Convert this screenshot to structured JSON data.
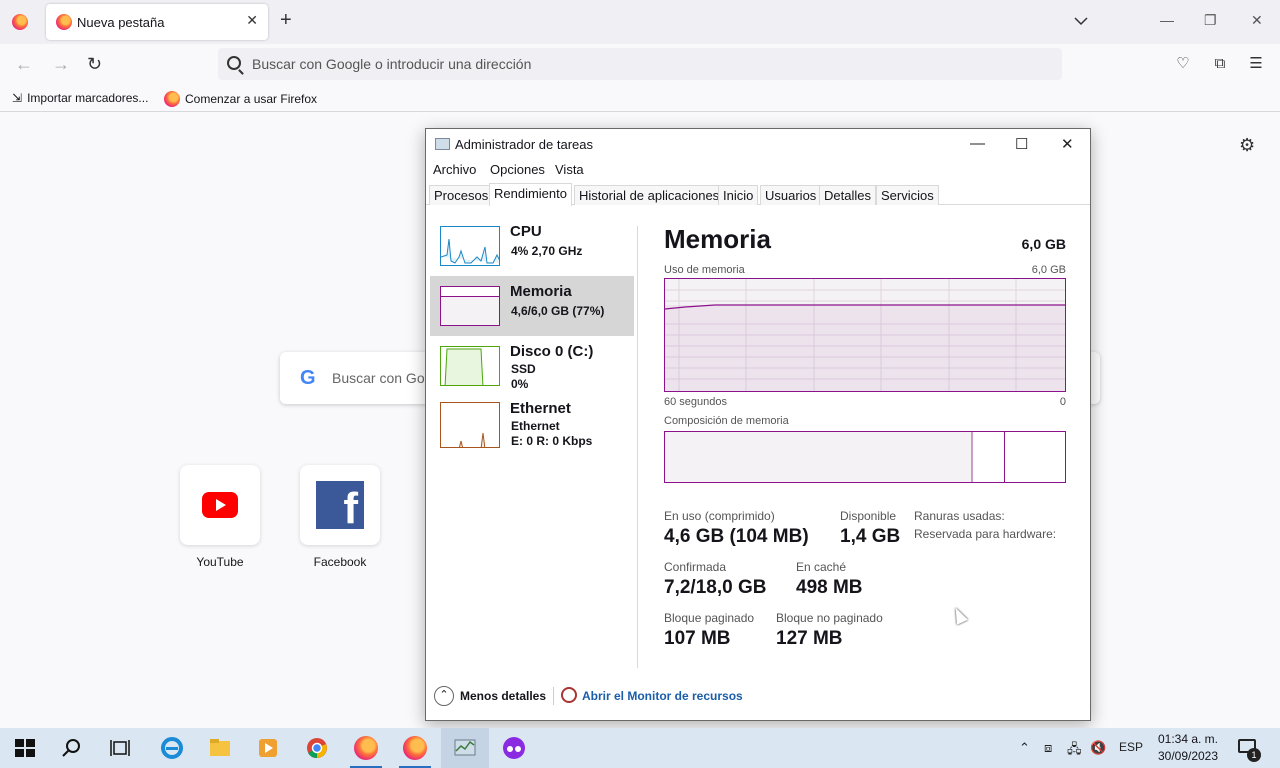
{
  "browser": {
    "tab_title": "Nueva pestaña",
    "url_placeholder": "Buscar con Google o introducir una dirección",
    "bookmarks": [
      "Importar marcadores...",
      "Comenzar a usar Firefox"
    ],
    "new_tab_label": "+",
    "google_search_placeholder": "Buscar con Google o introducir una dirección",
    "google_logo": "G",
    "shortcuts": [
      {
        "label": "YouTube",
        "icon": "youtube-icon"
      },
      {
        "label": "Facebook",
        "icon": "facebook-icon"
      }
    ]
  },
  "task_manager": {
    "title": "Administrador de tareas",
    "menu": [
      "Archivo",
      "Opciones",
      "Vista"
    ],
    "tabs": [
      "Procesos",
      "Rendimiento",
      "Historial de aplicaciones",
      "Inicio",
      "Usuarios",
      "Detalles",
      "Servicios"
    ],
    "active_tab": "Rendimiento",
    "perf_items": [
      {
        "name": "CPU",
        "sub1": "4% 2,70 GHz",
        "sub2": "",
        "color": "#1a88c8"
      },
      {
        "name": "Memoria",
        "sub1": "4,6/6,0 GB (77%)",
        "sub2": "",
        "color": "#8b128b"
      },
      {
        "name": "Disco 0 (C:)",
        "sub1": "SSD",
        "sub2": "0%",
        "color": "#4da60c"
      },
      {
        "name": "Ethernet",
        "sub1": "Ethernet",
        "sub2": "E: 0 R: 0 Kbps",
        "color": "#a7541d"
      }
    ],
    "detail": {
      "title": "Memoria",
      "total": "6,0 GB",
      "usage_label": "Uso de memoria",
      "usage_max": "6,0 GB",
      "time_left": "60 segundos",
      "time_right": "0",
      "composition_label": "Composición de memoria",
      "usage_fraction": 0.77,
      "stats": {
        "in_use_label": "En uso (comprimido)",
        "in_use": "4,6 GB (104 MB)",
        "available_label": "Disponible",
        "available": "1,4 GB",
        "committed_label": "Confirmada",
        "committed": "7,2/18,0 GB",
        "cached_label": "En caché",
        "cached": "498 MB",
        "paged_label": "Bloque paginado",
        "paged": "107 MB",
        "nonpaged_label": "Bloque no paginado",
        "nonpaged": "127 MB",
        "slots_label": "Ranuras usadas:",
        "hw_reserved_label": "Reservada para hardware:"
      }
    },
    "footer": {
      "less_details": "Menos detalles",
      "resource_monitor": "Abrir el Monitor de recursos"
    }
  },
  "taskbar": {
    "lang": "ESP",
    "time": "01:34 a. m.",
    "date": "30/09/2023",
    "notification_count": "1"
  }
}
